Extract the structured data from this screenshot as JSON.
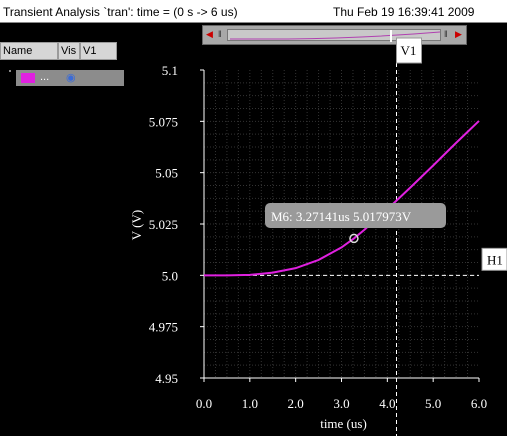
{
  "window": {
    "title": "Transient Analysis `tran': time = (0 s -> 6 us)",
    "timestamp": "Thu Feb 19 16:39:41 2009"
  },
  "signal_panel": {
    "headers": [
      "Name",
      "Vis",
      "V1"
    ],
    "signal_name": "...",
    "signal_color": "#e020e0",
    "visible_icon": "eye-icon"
  },
  "markers": {
    "vertical_label": "V1",
    "vertical_x": 4.2,
    "horizontal_label": "H1",
    "horizontal_y": 5.0,
    "point_label": "M6: 3.27141us 5.017973V"
  },
  "chart_data": {
    "type": "line",
    "xlabel": "time (us)",
    "ylabel": "V (V)",
    "xlim": [
      0,
      6
    ],
    "ylim": [
      4.95,
      5.1
    ],
    "x_ticks": [
      "0.0",
      "1.0",
      "2.0",
      "3.0",
      "4.0",
      "5.0",
      "6.0"
    ],
    "y_ticks": [
      "4.95",
      "4.975",
      "5.0",
      "5.025",
      "5.05",
      "5.075",
      "5.1"
    ],
    "grid": true,
    "series": [
      {
        "color": "#e020e0",
        "x": [
          0,
          0.5,
          1.0,
          1.5,
          2.0,
          2.5,
          3.0,
          3.27141,
          3.5,
          4.0,
          4.5,
          5.0,
          5.5,
          6.0
        ],
        "y": [
          5.0,
          5.0,
          5.0002,
          5.0013,
          5.0035,
          5.0075,
          5.0136,
          5.017973,
          5.0222,
          5.0322,
          5.0427,
          5.0535,
          5.0645,
          5.0752
        ]
      }
    ],
    "marked_point": {
      "x": 3.27141,
      "y": 5.017973
    }
  }
}
